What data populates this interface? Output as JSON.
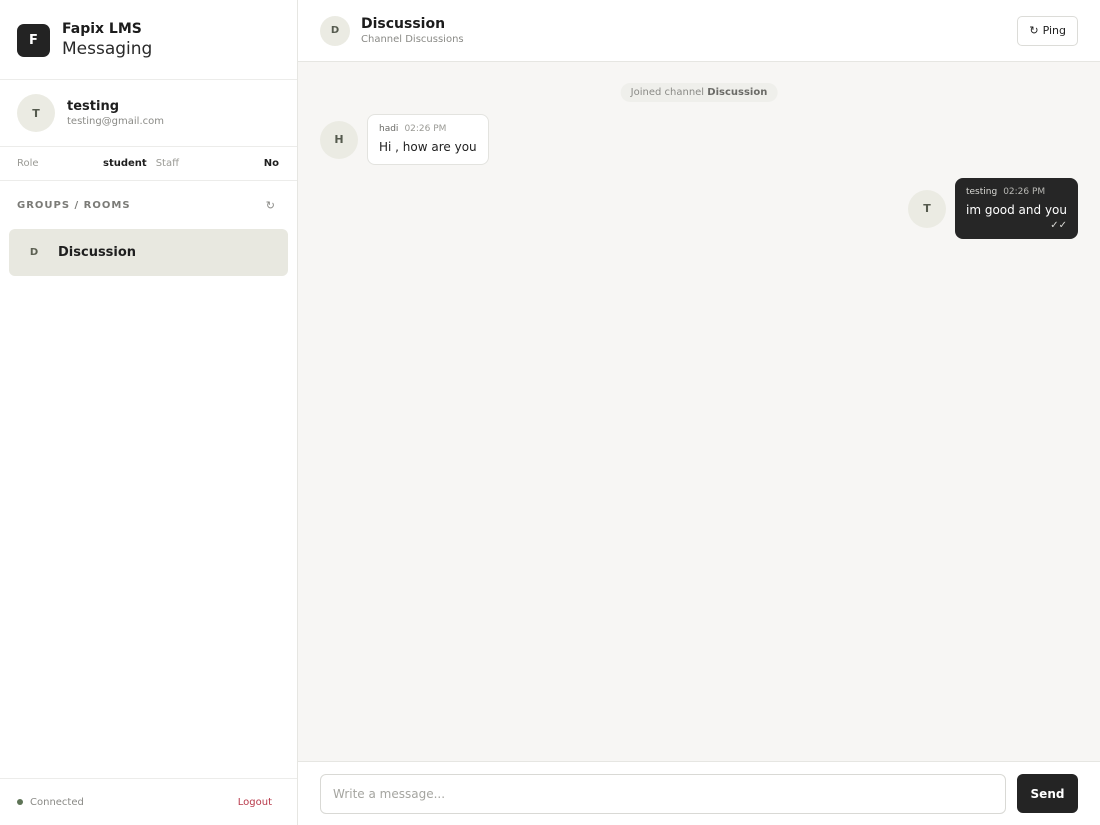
{
  "brand": {
    "logo_letter": "F",
    "name": "Fapix LMS",
    "subtitle": "Messaging"
  },
  "user": {
    "initial": "T",
    "name": "testing",
    "email": "testing@gmail.com"
  },
  "role": {
    "label": "Role",
    "value": "student",
    "staff_label": "Staff",
    "staff_value": "No"
  },
  "groups": {
    "title": "GROUPS / ROOMS",
    "refresh_icon": "↻",
    "items": [
      {
        "initial": "D",
        "name": "Discussion",
        "active": true
      }
    ]
  },
  "footer": {
    "status": "Connected",
    "logout": "Logout"
  },
  "channel": {
    "initial": "D",
    "title": "Discussion",
    "subtitle": "Channel Discussions",
    "ping_icon": "↻",
    "ping_label": "Ping"
  },
  "system_note": {
    "prefix": "Joined channel ",
    "channel": "Discussion"
  },
  "messages": [
    {
      "direction": "in",
      "initial": "H",
      "author": "hadi",
      "time": "02:26 PM",
      "text": "Hi , how are you"
    },
    {
      "direction": "out",
      "initial": "T",
      "author": "testing",
      "time": "02:26 PM",
      "text": "im good and you",
      "status": "✓✓"
    }
  ],
  "composer": {
    "placeholder": "Write a message...",
    "send_label": "Send"
  },
  "colors": {
    "accent_dark": "#242424",
    "active_room_bg": "#e8e8e0",
    "logout": "#b8394a",
    "online_dot": "#5e7456"
  }
}
